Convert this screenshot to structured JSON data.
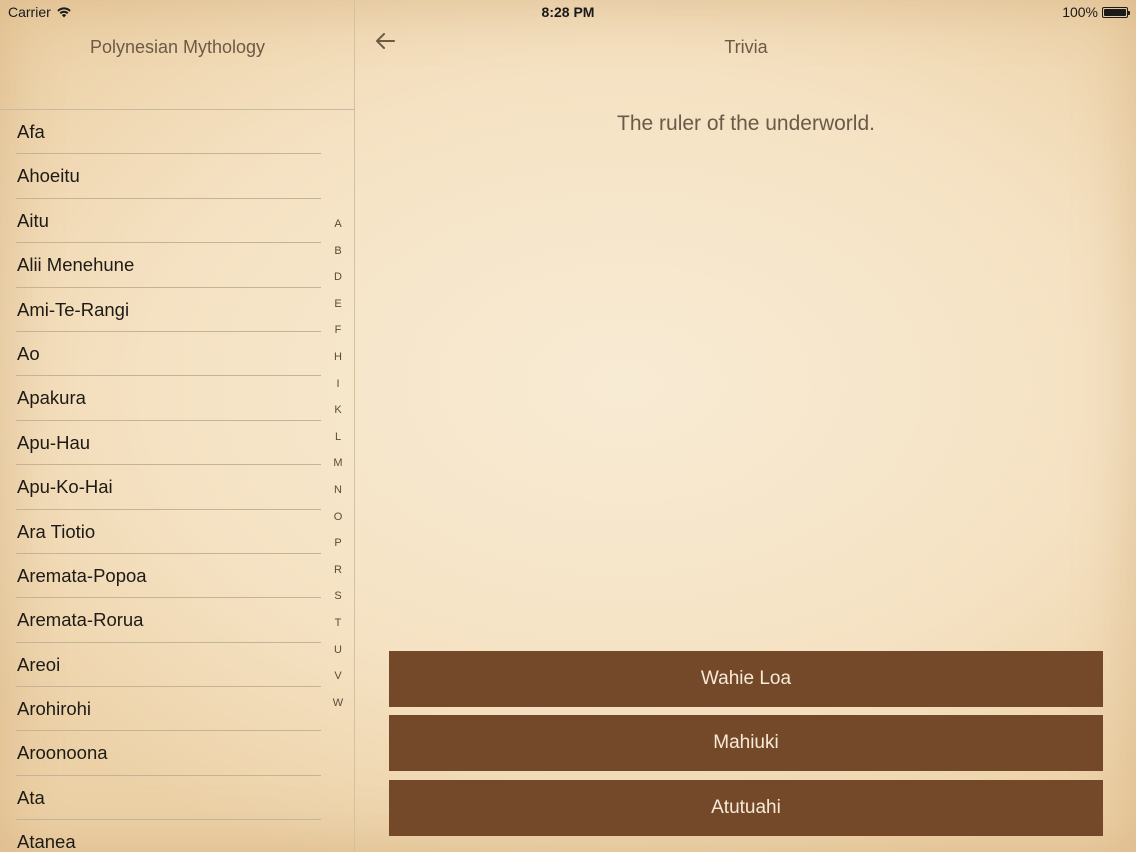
{
  "status_bar": {
    "carrier": "Carrier",
    "time": "8:28 PM",
    "battery": "100%"
  },
  "sidebar": {
    "title": "Polynesian Mythology",
    "items": [
      "Afa",
      "Ahoeitu",
      "Aitu",
      "Alii Menehune",
      "Ami-Te-Rangi",
      "Ao",
      "Apakura",
      "Apu-Hau",
      "Apu-Ko-Hai",
      "Ara Tiotio",
      "Aremata-Popoa",
      "Aremata-Rorua",
      "Areoi",
      "Arohirohi",
      "Aroonoona",
      "Ata",
      "Atanea"
    ],
    "index_letters": [
      "A",
      "B",
      "D",
      "E",
      "F",
      "H",
      "I",
      "K",
      "L",
      "M",
      "N",
      "O",
      "P",
      "R",
      "S",
      "T",
      "U",
      "V",
      "W"
    ]
  },
  "main": {
    "title": "Trivia",
    "question": "The ruler of the underworld.",
    "answers": [
      "Wahie Loa",
      "Mahiuki",
      "Atutuahi"
    ]
  },
  "colors": {
    "answer_button": "#74492a",
    "answer_text": "#f7ead7",
    "title_text": "#6d5a45"
  },
  "icons": {
    "back": "arrow-left-icon",
    "wifi": "wifi-icon",
    "battery": "battery-icon"
  }
}
